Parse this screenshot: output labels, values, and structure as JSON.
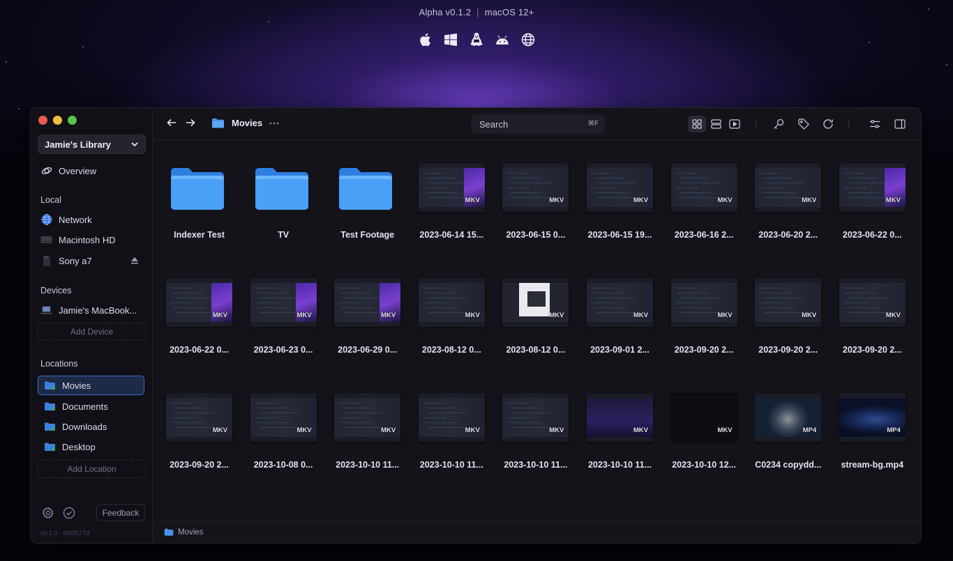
{
  "hero": {
    "version": "Alpha v0.1.2",
    "os": "macOS 12+",
    "platforms": [
      "apple-icon",
      "windows-icon",
      "linux-icon",
      "android-icon",
      "web-icon"
    ]
  },
  "sidebar": {
    "library": "Jamie's Library",
    "overview": "Overview",
    "local_heading": "Local",
    "local": [
      {
        "label": "Network",
        "icon": "globe-icon"
      },
      {
        "label": "Macintosh HD",
        "icon": "drive-icon"
      },
      {
        "label": "Sony a7",
        "icon": "sd-card-icon"
      }
    ],
    "devices_heading": "Devices",
    "device": "Jamie's MacBook...",
    "add_device": "Add Device",
    "locations_heading": "Locations",
    "locations": [
      "Movies",
      "Documents",
      "Downloads",
      "Desktop"
    ],
    "add_location": "Add Location",
    "feedback": "Feedback",
    "build": "v0.1.0 - 06f9577d"
  },
  "toolbar": {
    "current": "Movies",
    "search_placeholder": "Search",
    "search_shortcut": "⌘F"
  },
  "items": [
    {
      "name": "Indexer Test",
      "type": "folder"
    },
    {
      "name": "TV",
      "type": "folder"
    },
    {
      "name": "Test Footage",
      "type": "folder"
    },
    {
      "name": "2023-06-14 15...",
      "type": "MKV",
      "style": "purple"
    },
    {
      "name": "2023-06-15 0...",
      "type": "MKV",
      "style": "code"
    },
    {
      "name": "2023-06-15 19...",
      "type": "MKV",
      "style": "code"
    },
    {
      "name": "2023-06-16 2...",
      "type": "MKV",
      "style": "code"
    },
    {
      "name": "2023-06-20 2...",
      "type": "MKV",
      "style": "code"
    },
    {
      "name": "2023-06-22 0...",
      "type": "MKV",
      "style": "purple"
    },
    {
      "name": "2023-06-22 0...",
      "type": "MKV",
      "style": "purple"
    },
    {
      "name": "2023-06-23 0...",
      "type": "MKV",
      "style": "purple"
    },
    {
      "name": "2023-06-29 0...",
      "type": "MKV",
      "style": "purple"
    },
    {
      "name": "2023-08-12 0...",
      "type": "MKV",
      "style": "code"
    },
    {
      "name": "2023-08-12 0...",
      "type": "MKV",
      "style": "white"
    },
    {
      "name": "2023-09-01 2...",
      "type": "MKV",
      "style": "code"
    },
    {
      "name": "2023-09-20 2...",
      "type": "MKV",
      "style": "code"
    },
    {
      "name": "2023-09-20 2...",
      "type": "MKV",
      "style": "code"
    },
    {
      "name": "2023-09-20 2...",
      "type": "MKV",
      "style": "code"
    },
    {
      "name": "2023-09-20 2...",
      "type": "MKV",
      "style": "code"
    },
    {
      "name": "2023-10-08 0...",
      "type": "MKV",
      "style": "code"
    },
    {
      "name": "2023-10-10 11...",
      "type": "MKV",
      "style": "code"
    },
    {
      "name": "2023-10-10 11...",
      "type": "MKV",
      "style": "code"
    },
    {
      "name": "2023-10-10 11...",
      "type": "MKV",
      "style": "code"
    },
    {
      "name": "2023-10-10 11...",
      "type": "MKV",
      "style": "face"
    },
    {
      "name": "2023-10-10 12...",
      "type": "MKV",
      "style": "black"
    },
    {
      "name": "C0234 copydd...",
      "type": "MP4",
      "style": "portrait"
    },
    {
      "name": "stream-bg.mp4",
      "type": "MP4",
      "style": "nebula"
    }
  ],
  "statusbar": {
    "path": "Movies"
  }
}
